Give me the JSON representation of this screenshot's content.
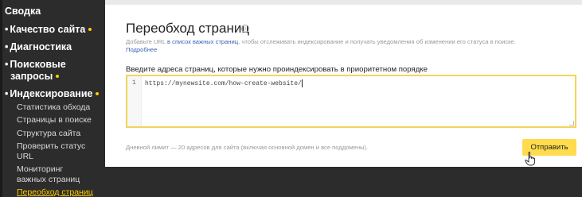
{
  "sidebar": {
    "items": [
      {
        "label": "Сводка",
        "bullet": "",
        "dot": false
      },
      {
        "label": "Качество сайта",
        "bullet": "•",
        "dot": true
      },
      {
        "label": "Диагностика",
        "bullet": "•",
        "dot": false
      },
      {
        "label": "Поисковые",
        "bullet": "•",
        "dot": false
      },
      {
        "label": "запросы",
        "bullet": "",
        "dot": true
      },
      {
        "label": "Индексирование",
        "bullet": "•",
        "dot": true
      }
    ],
    "subitems": [
      {
        "label": "Статистика обхода"
      },
      {
        "label": "Страницы в поиске"
      },
      {
        "label": "Структура сайта"
      },
      {
        "label": "Проверить статус"
      },
      {
        "label": "URL"
      },
      {
        "label": "Мониторинг"
      },
      {
        "label": "важных страниц"
      },
      {
        "label": "Переобход страниц",
        "active": true
      }
    ]
  },
  "page": {
    "title": "Переобход страниц",
    "info_icon": "i",
    "desc_before": "Добавьте URL ",
    "desc_link": "в список важных страниц",
    "desc_after": ", чтобы отслеживать индексирование и получать уведомления об изменении его статуса в поиске.",
    "more_link": "Подробнее",
    "input_label": "Введите адреса страниц, которые нужно проиндексировать в приоритетном порядке",
    "editor": {
      "line_number": "1",
      "value": "https://mynewsite.com/how-create-website/"
    },
    "limit_text": "Дневной лимит — 20 адресов для сайта (включая основной домен и все поддомены).",
    "submit_label": "Отправить"
  },
  "colors": {
    "accent": "#ffdb4d",
    "sidebar_bg": "#2c2c2c",
    "link": "#3a63b8",
    "dot": "#ffcc00"
  }
}
